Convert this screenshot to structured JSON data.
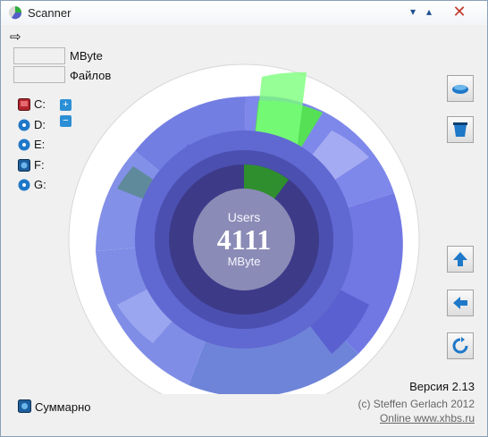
{
  "window": {
    "title": "Scanner",
    "controls": {
      "minimize": "▾",
      "restore": "▴",
      "close": "✕"
    }
  },
  "toolbar": {
    "forward_icon": "⇨"
  },
  "stats": {
    "mbyte_value": "",
    "mbyte_label": "MByte",
    "files_value": "",
    "files_label": "Файлов"
  },
  "drives": [
    {
      "label": "C:",
      "icon": "hdd-red-icon"
    },
    {
      "label": "D:",
      "icon": "cd-icon"
    },
    {
      "label": "E:",
      "icon": "cd-icon"
    },
    {
      "label": "F:",
      "icon": "network-drive-icon"
    },
    {
      "label": "G:",
      "icon": "cd-icon"
    }
  ],
  "zoom_buttons": {
    "plus": "+",
    "minus": "−"
  },
  "center": {
    "name": "Users",
    "size": "4111",
    "unit": "MByte"
  },
  "side_buttons": [
    "hdd-icon",
    "trash-icon",
    "up-icon",
    "back-icon",
    "refresh-icon"
  ],
  "footer": {
    "version": "Версия 2.13",
    "copyright": "(c) Steffen Gerlach 2012",
    "online": "Online www.xhbs.ru",
    "summary_label": "Суммарно"
  },
  "colors": {
    "accent": "#2c8fd6",
    "ring": "#5d63c9",
    "highlight": "#33cc33",
    "center": "#8b8bb7"
  }
}
